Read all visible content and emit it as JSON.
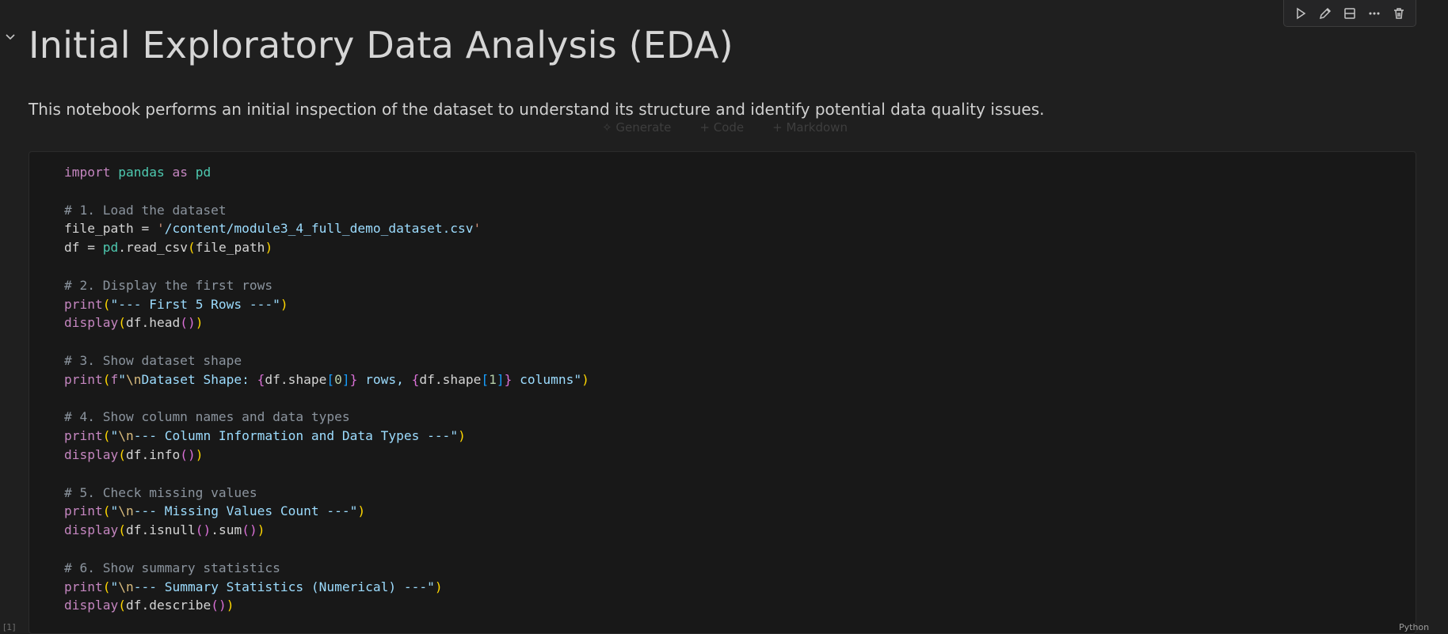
{
  "toolbar": {
    "buttons": [
      {
        "name": "run-icon"
      },
      {
        "name": "edit-icon"
      },
      {
        "name": "split-cell-icon"
      },
      {
        "name": "more-icon"
      },
      {
        "name": "delete-icon"
      }
    ]
  },
  "markdown": {
    "title": "Initial Exploratory Data Analysis (EDA)",
    "description": "This notebook performs an initial inspection of the dataset to understand its structure and identify potential data quality issues."
  },
  "insert_bar": {
    "generate": "✧ Generate",
    "code": "+ Code",
    "markdown": "+ Markdown"
  },
  "code_cell": {
    "execution_count": "[1]",
    "language": "Python",
    "lines": [
      "import pandas as pd",
      "",
      "# 1. Load the dataset",
      "file_path = '/content/module3_4_full_demo_dataset.csv'",
      "df = pd.read_csv(file_path)",
      "",
      "# 2. Display the first rows",
      "print(\"--- First 5 Rows ---\")",
      "display(df.head())",
      "",
      "# 3. Show dataset shape",
      "print(f\"\\nDataset Shape: {df.shape[0]} rows, {df.shape[1]} columns\")",
      "",
      "# 4. Show column names and data types",
      "print(\"\\n--- Column Information and Data Types ---\")",
      "display(df.info())",
      "",
      "# 5. Check missing values",
      "print(\"\\n--- Missing Values Count ---\")",
      "display(df.isnull().sum())",
      "",
      "# 6. Show summary statistics",
      "print(\"\\n--- Summary Statistics (Numerical) ---\")",
      "display(df.describe())"
    ]
  }
}
